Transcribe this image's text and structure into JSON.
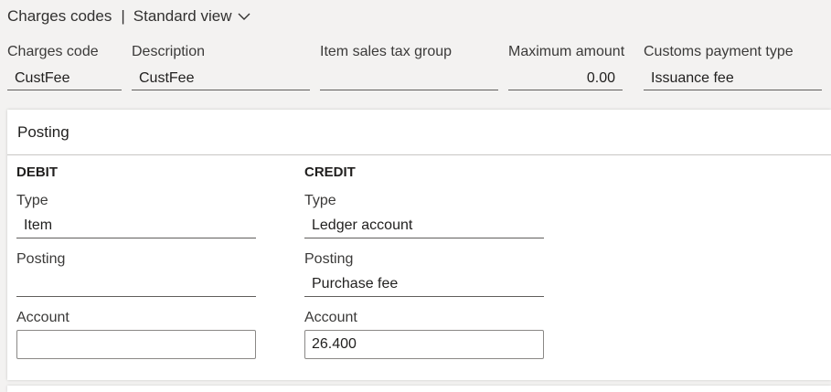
{
  "header": {
    "title": "Charges codes",
    "separator": "|",
    "view": "Standard view",
    "view_icon": "chevron-down-icon"
  },
  "fields": {
    "charges_code": {
      "label": "Charges code",
      "value": "CustFee"
    },
    "description": {
      "label": "Description",
      "value": "CustFee"
    },
    "item_sales_tax_group": {
      "label": "Item sales tax group",
      "value": ""
    },
    "maximum_amount": {
      "label": "Maximum amount",
      "value": "0.00"
    },
    "customs_payment_type": {
      "label": "Customs payment type",
      "value": "Issuance fee"
    }
  },
  "posting": {
    "title": "Posting",
    "debit": {
      "heading": "DEBIT",
      "type": {
        "label": "Type",
        "value": "Item"
      },
      "posting": {
        "label": "Posting",
        "value": ""
      },
      "account": {
        "label": "Account",
        "value": ""
      }
    },
    "credit": {
      "heading": "CREDIT",
      "type": {
        "label": "Type",
        "value": "Ledger account"
      },
      "posting": {
        "label": "Posting",
        "value": "Purchase fee"
      },
      "account": {
        "label": "Account",
        "value": "26.400"
      }
    }
  }
}
